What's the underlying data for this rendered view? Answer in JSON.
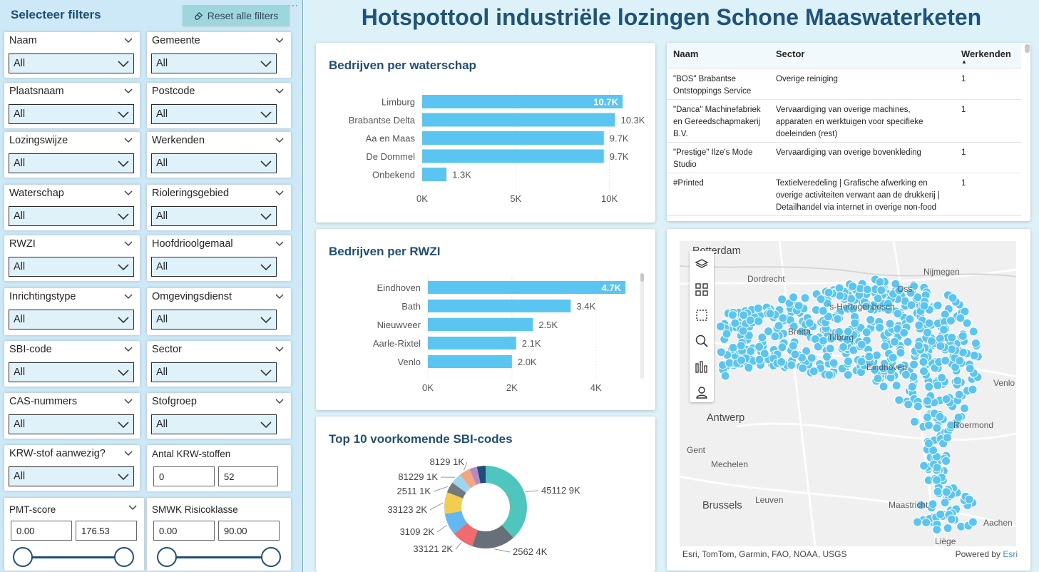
{
  "filters": {
    "title": "Selecteer filters",
    "reset_label": "Reset alle filters",
    "more": "···",
    "slicers": [
      {
        "label": "Naam",
        "value": "All"
      },
      {
        "label": "Gemeente",
        "value": "All"
      },
      {
        "label": "Plaatsnaam",
        "value": "All"
      },
      {
        "label": "Postcode",
        "value": "All"
      },
      {
        "label": "Lozingswijze",
        "value": "All"
      },
      {
        "label": "Werkenden",
        "value": "All"
      },
      {
        "label": "Waterschap",
        "value": "All"
      },
      {
        "label": "Rioleringsgebied",
        "value": "All"
      },
      {
        "label": "RWZI",
        "value": "All"
      },
      {
        "label": "Hoofdrioolgemaal",
        "value": "All"
      },
      {
        "label": "Inrichtingstype",
        "value": "All"
      },
      {
        "label": "Omgevingsdienst",
        "value": "All"
      },
      {
        "label": "SBI-code",
        "value": "All"
      },
      {
        "label": "Sector",
        "value": "All"
      },
      {
        "label": "CAS-nummers",
        "value": "All"
      },
      {
        "label": "Stofgroep",
        "value": "All"
      },
      {
        "label": "KRW-stof aanwezig?",
        "value": "All"
      }
    ],
    "krw": {
      "label": "Antal KRW-stoffen",
      "min": "0",
      "max": "52"
    },
    "pmt": {
      "label": "PMT-score",
      "min": "0.00",
      "max": "176.53",
      "from_pct": 0,
      "to_pct": 100
    },
    "smwk": {
      "label": "SMWK Risicoklasse",
      "min": "0.00",
      "max": "90.00",
      "from_pct": 0,
      "to_pct": 100
    }
  },
  "main": {
    "title": "Hotspottool industriële lozingen Schone Maaswaterketen"
  },
  "chart_waterschap": {
    "title": "Bedrijven per waterschap",
    "chart_data": {
      "type": "bar",
      "orientation": "horizontal",
      "categories": [
        "Limburg",
        "Brabantse Delta",
        "Aa en Maas",
        "De Dommel",
        "Onbekend"
      ],
      "values": [
        10700,
        10300,
        9700,
        9700,
        1300
      ],
      "labels": [
        "10.7K",
        "10.3K",
        "9.7K",
        "9.7K",
        "1.3K"
      ],
      "ticks": [
        "0K",
        "5K",
        "10K"
      ],
      "tick_values": [
        0,
        5000,
        10000
      ],
      "xlim": [
        0,
        10700
      ],
      "color": "#5bc5f2"
    }
  },
  "chart_rwzi": {
    "title": "Bedrijven per RWZI",
    "chart_data": {
      "type": "bar",
      "orientation": "horizontal",
      "categories": [
        "Eindhoven",
        "Bath",
        "Nieuwveer",
        "Aarle-Rixtel",
        "Venlo"
      ],
      "values": [
        4700,
        3400,
        2500,
        2100,
        2000
      ],
      "labels": [
        "4.7K",
        "3.4K",
        "2.5K",
        "2.1K",
        "2.0K"
      ],
      "ticks": [
        "0K",
        "2K",
        "4K"
      ],
      "tick_values": [
        0,
        2000,
        4000
      ],
      "xlim": [
        0,
        4700
      ],
      "color": "#5bc5f2"
    }
  },
  "chart_sbi": {
    "title": "Top 10 voorkomende SBI-codes",
    "chart_data": {
      "type": "pie",
      "donut": true,
      "labels": [
        "45112",
        "2562",
        "33121",
        "3109",
        "33123",
        "2511",
        "81229",
        "8129",
        "",
        ""
      ],
      "values": [
        9000,
        4000,
        2000,
        2000,
        2000,
        1000,
        1000,
        1000,
        700,
        800
      ],
      "value_labels": [
        "9K",
        "4K",
        "2K",
        "2K",
        "2K",
        "1K",
        "1K",
        "1K",
        "",
        ""
      ],
      "colors": [
        "#4ec6bd",
        "#677078",
        "#f06b6e",
        "#63b8f2",
        "#f3cd4f",
        "#727a80",
        "#9ed6ee",
        "#f4a582",
        "#b58bc2",
        "#1f4e79"
      ]
    }
  },
  "table": {
    "columns": [
      "Naam",
      "Sector",
      "Werkenden"
    ],
    "sort_indicator": "▲",
    "rows": [
      {
        "naam": [
          "\"BOS\" Brabantse",
          "Ontstoppings Service"
        ],
        "sector": [
          "Overige reiniging"
        ],
        "werkenden": "1"
      },
      {
        "naam": [
          "\"Danca\" Machinefabriek",
          "en Gereedschapmakerij",
          "B.V."
        ],
        "sector": [
          "Vervaardiging van overige machines,",
          "apparaten en werktuigen voor specifieke",
          "doeleinden (rest)"
        ],
        "werkenden": "1"
      },
      {
        "naam": [
          "\"Prestige\" Ilze's Mode",
          "Studio"
        ],
        "sector": [
          "Vervaardiging van overige bovenkleding"
        ],
        "werkenden": "1"
      },
      {
        "naam": [
          "#Printed"
        ],
        "sector": [
          "Textielveredeling | Grafische afwerking en",
          "overige activiteiten verwant aan de drukkerij |",
          "Detailhandel via internet in overige non-food"
        ],
        "werkenden": "1"
      }
    ]
  },
  "map": {
    "cities": [
      "Rotterdam",
      "Dordrecht",
      "Nijmegen",
      "Oss",
      "'s-Hertogenbosch",
      "Breda",
      "Tilburg",
      "Eindhoven",
      "Venlo",
      "Roermond",
      "Antwerp",
      "Gent",
      "Mechelen",
      "Leuven",
      "Brussels",
      "Maastricht",
      "Aachen",
      "Liège"
    ],
    "credit": "Esri, TomTom, Garmin, FAO, NOAA, USGS",
    "powered_prefix": "Powered by ",
    "powered_brand": "Esri",
    "point_color": "#5bc5f2"
  }
}
